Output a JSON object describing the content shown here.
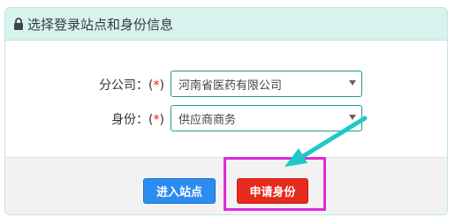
{
  "header": {
    "title": "选择登录站点和身份信息",
    "icon": "lock-icon"
  },
  "form": {
    "branch": {
      "label_prefix": "分公司：(",
      "required_mark": "*",
      "label_suffix": ")",
      "value": "河南省医药有限公司"
    },
    "identity": {
      "label_prefix": "身份：(",
      "required_mark": "*",
      "label_suffix": ")",
      "value": "供应商商务"
    }
  },
  "actions": {
    "enter_label": "进入站点",
    "apply_label": "申请身份"
  },
  "colors": {
    "accent": "#1f9b8e",
    "enter_button": "#2d8cf0",
    "apply_button": "#e72a1c",
    "highlight": "#e02ad8",
    "arrow": "#1ec8c8"
  }
}
